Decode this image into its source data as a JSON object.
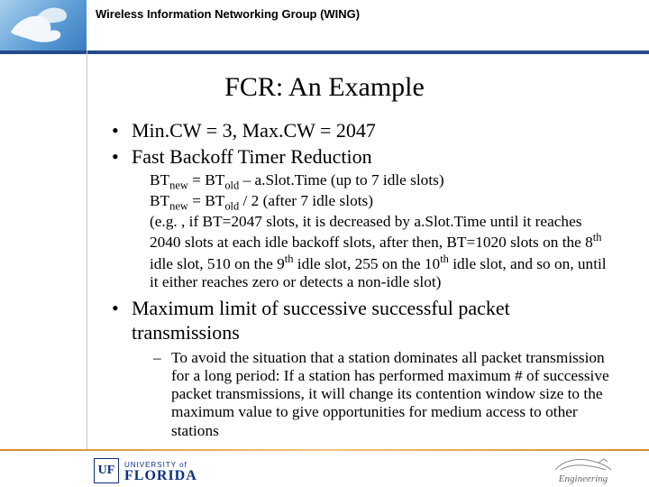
{
  "header": {
    "group": "Wireless Information Networking Group (WING)"
  },
  "title": "FCR: An Example",
  "bullets": {
    "b1": "Min.CW = 3, Max.CW = 2047",
    "b2": "Fast Backoff Timer Reduction",
    "b3": "Maximum limit of successive successful packet transmissions"
  },
  "sub": {
    "line1_pre": "BT",
    "line1_sub1": "new",
    "line1_mid1": " =  BT",
    "line1_sub2": "old",
    "line1_post": " – a.Slot.Time   (up to 7 idle slots)",
    "line2_pre": "BT",
    "line2_sub1": "new",
    "line2_mid1": " =  BT",
    "line2_sub2": "old",
    "line2_post": " / 2  (after 7 idle slots)",
    "para_a": "(e.g. , if BT=2047 slots, it is decreased by a.Slot.Time until it reaches 2040 slots at each idle backoff slots, after then, BT=1020 slots on the 8",
    "para_sup1": "th",
    "para_b": " idle slot, 510 on the 9",
    "para_sup2": "th",
    "para_c": " idle slot, 255 on the 10",
    "para_sup3": "th",
    "para_d": " idle slot, and so on, until it either reaches zero or detects a non-idle slot)"
  },
  "dash": {
    "text": "To avoid the situation that a station dominates all packet transmission for a long period: If a station has performed maximum # of successive packet transmissions, it will change its contention window size to the maximum value to give opportunities for medium access to other stations"
  },
  "footer": {
    "uf_small": "UNIVERSITY of",
    "uf_big": "FLORIDA",
    "uf_mark": "UF",
    "eng": "Engineering"
  }
}
